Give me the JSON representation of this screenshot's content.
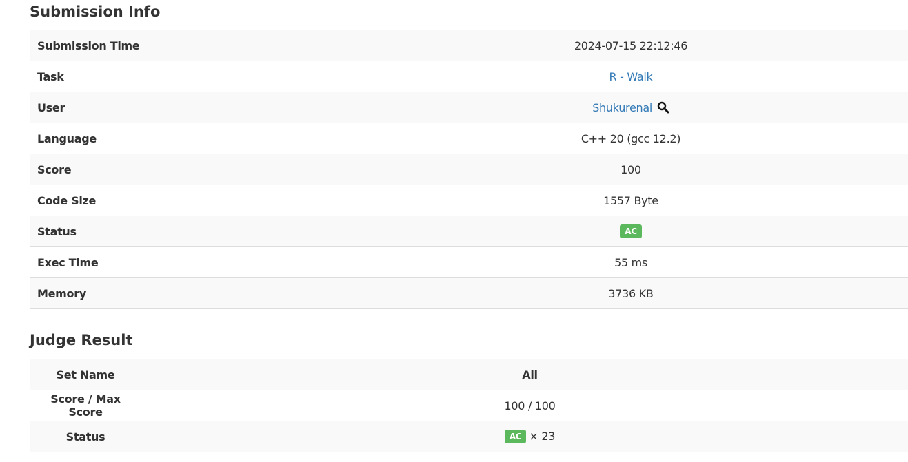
{
  "submission_info": {
    "title": "Submission Info",
    "rows": {
      "submission_time": {
        "label": "Submission Time",
        "value": "2024-07-15 22:12:46"
      },
      "task": {
        "label": "Task",
        "value": "R - Walk"
      },
      "user": {
        "label": "User",
        "value": "Shukurenai",
        "icon": "search-icon"
      },
      "language": {
        "label": "Language",
        "value": "C++ 20 (gcc 12.2)"
      },
      "score": {
        "label": "Score",
        "value": "100"
      },
      "code_size": {
        "label": "Code Size",
        "value": "1557 Byte"
      },
      "status": {
        "label": "Status",
        "value": "AC",
        "color": "#5cb85c"
      },
      "exec_time": {
        "label": "Exec Time",
        "value": "55 ms"
      },
      "memory": {
        "label": "Memory",
        "value": "3736 KB"
      }
    }
  },
  "judge_result": {
    "title": "Judge Result",
    "set_name": {
      "label": "Set Name",
      "value": "All"
    },
    "score": {
      "label": "Score / Max Score",
      "value": "100 / 100"
    },
    "status": {
      "label": "Status",
      "badge": "AC",
      "count": "× 23",
      "color": "#5cb85c"
    }
  },
  "colors": {
    "link": "#337ab7",
    "accepted": "#5cb85c",
    "border": "#dddddd",
    "stripe": "#f9f9f9"
  }
}
